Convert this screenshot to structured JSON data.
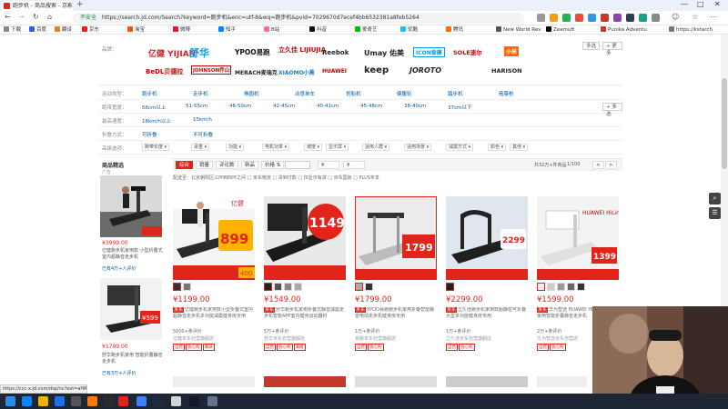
{
  "browser": {
    "tab_title": "跑步机 - 商品搜索 - 京东",
    "url": "https://search.jd.com/Search?keyword=跑步机&enc=utf-8&wq=跑步机&pvid=7029670d7ecef4bb6532381a8feb5264",
    "security_label": "不安全",
    "bookmarks": [
      "下载",
      "百度",
      "翻译",
      "京东",
      "淘宝",
      "微博",
      "知乎",
      "B站",
      "抖音",
      "爱奇艺",
      "优酷",
      "腾讯",
      "New World Rev",
      "Zeamuft",
      "Punika Adventu",
      "https://kstarch"
    ]
  },
  "filters": {
    "brand_label": "品牌：",
    "brand_more": "多选",
    "brand_collapse": "+ 更多",
    "brands_row1": [
      "亿健 YIJIAN",
      "舒华",
      "YPOO易跑",
      "立久佳 LIJIUJIA",
      "Reebok",
      "Umay 佑美",
      "ICON爱康",
      "SOLE速尔",
      "小米"
    ],
    "brands_row2": [
      "BeDL贝德拉",
      "JOHNSON乔山",
      "MERACH麦瑞克",
      "XIAOMO小莫",
      "HUAWEI",
      "keep",
      "JOROTO",
      "HARISON"
    ],
    "rows": [
      {
        "label": "运动类型：",
        "items": [
          "跑步机",
          "走步机",
          "椭圆机",
          "动感单车",
          "划船机",
          "健腹轮",
          "踏步机",
          "筋膜枪"
        ]
      },
      {
        "label": "跑带宽度：",
        "items": [
          "56cm以上",
          "51-55cm",
          "46-50cm",
          "42-45cm",
          "40-41cm",
          "45-48cm",
          "38-40cm",
          "37cm以下"
        ],
        "more": "+ 多选"
      },
      {
        "label": "最高速度：",
        "items": [
          "16km/h以上",
          "15km/h"
        ]
      },
      {
        "label": "折叠方式：",
        "items": [
          "可折叠",
          "不可折叠"
        ]
      }
    ],
    "dropdowns_label": "高级选项：",
    "dropdowns": [
      "跑带长度",
      "承重",
      "功能",
      "电机功率",
      "坡度",
      "显示屏",
      "适用人群",
      "适用场景",
      "减震方式",
      "颜色",
      "其他"
    ]
  },
  "sortbar": {
    "buttons": [
      "综合",
      "销量",
      "评论数",
      "新品",
      "价格"
    ],
    "price_from": "¥",
    "price_to": "¥",
    "checks": [
      "京东物流",
      "货到付款",
      "仅显示有货",
      "京东国际"
    ],
    "count_text": "共32万+件商品",
    "page_text": "1/100",
    "prev": "<",
    "next": ">"
  },
  "filter2": "配送至：北京朝阳区三环到四环之间  □ 京东物流  □ 货到付款  □ 仅显示有货  □ 京东国际  □ PLUS专享",
  "left_panel": {
    "title": "商品精选",
    "ad": "广告",
    "items": [
      {
        "price": "¥3999.00",
        "text": "亿健跑步机家用款 小型折叠式室内超静音走步机",
        "sub": "已有4万+人评价"
      },
      {
        "price": "¥1799.00",
        "text": "舒华跑步机家用 智能折叠静音走步机",
        "sub": "已有3万+人评价"
      }
    ]
  },
  "products": [
    {
      "price": "¥1199.00",
      "badge": "899",
      "tag1": "京东",
      "title": "亿健跑步机家用款小型折叠式室内超静音走步机多功能减震健身房专用",
      "comments": "5000+条评价",
      "shop": "亿健京东自营旗舰店",
      "badges": [
        "自营",
        "放心购",
        "满减"
      ]
    },
    {
      "price": "¥1549.00",
      "badge": "1149",
      "tag1": "京东",
      "title": "舒华跑步机家用折叠式静音减震走步机智能APP室内健身运动器材",
      "comments": "5万+条评价",
      "shop": "舒华京东自营旗舰店",
      "badges": [
        "自营",
        "放心购",
        "满赠"
      ]
    },
    {
      "price": "¥1799.00",
      "badge": "1799",
      "tag1": "京东",
      "title": "YPOO易跑跑步机家用折叠智能静音电动走步机健身房专用",
      "comments": "1万+条评价",
      "shop": "易跑京东自营旗舰店",
      "badges": [
        "自营",
        "放心购"
      ]
    },
    {
      "price": "¥2299.00",
      "badge": "2299",
      "tag1": "京东",
      "title": "立久佳跑步机家用款超静音可折叠大型多功能健身房专用",
      "comments": "1万+条评价",
      "shop": "立久佳京东自营旗舰店",
      "badges": [
        "自营",
        "放心购"
      ]
    },
    {
      "price": "¥1599.00",
      "badge": "1399",
      "tag1": "京东",
      "title": "华为智选 HUAWEI HiLink跑步机家用智能折叠静音走步机",
      "comments": "2万+条评价",
      "shop": "华为智选京东自营店",
      "badges": [
        "自营",
        "放心购"
      ]
    }
  ],
  "status_url": "https://ccc-x.jd.com/dsp/nc?ext=aHR0cHM6Ly9pdGVtLmpk",
  "colors": {
    "jd_red": "#e1251b",
    "link_blue": "#005aa0",
    "taskbar": "#1c2634"
  }
}
